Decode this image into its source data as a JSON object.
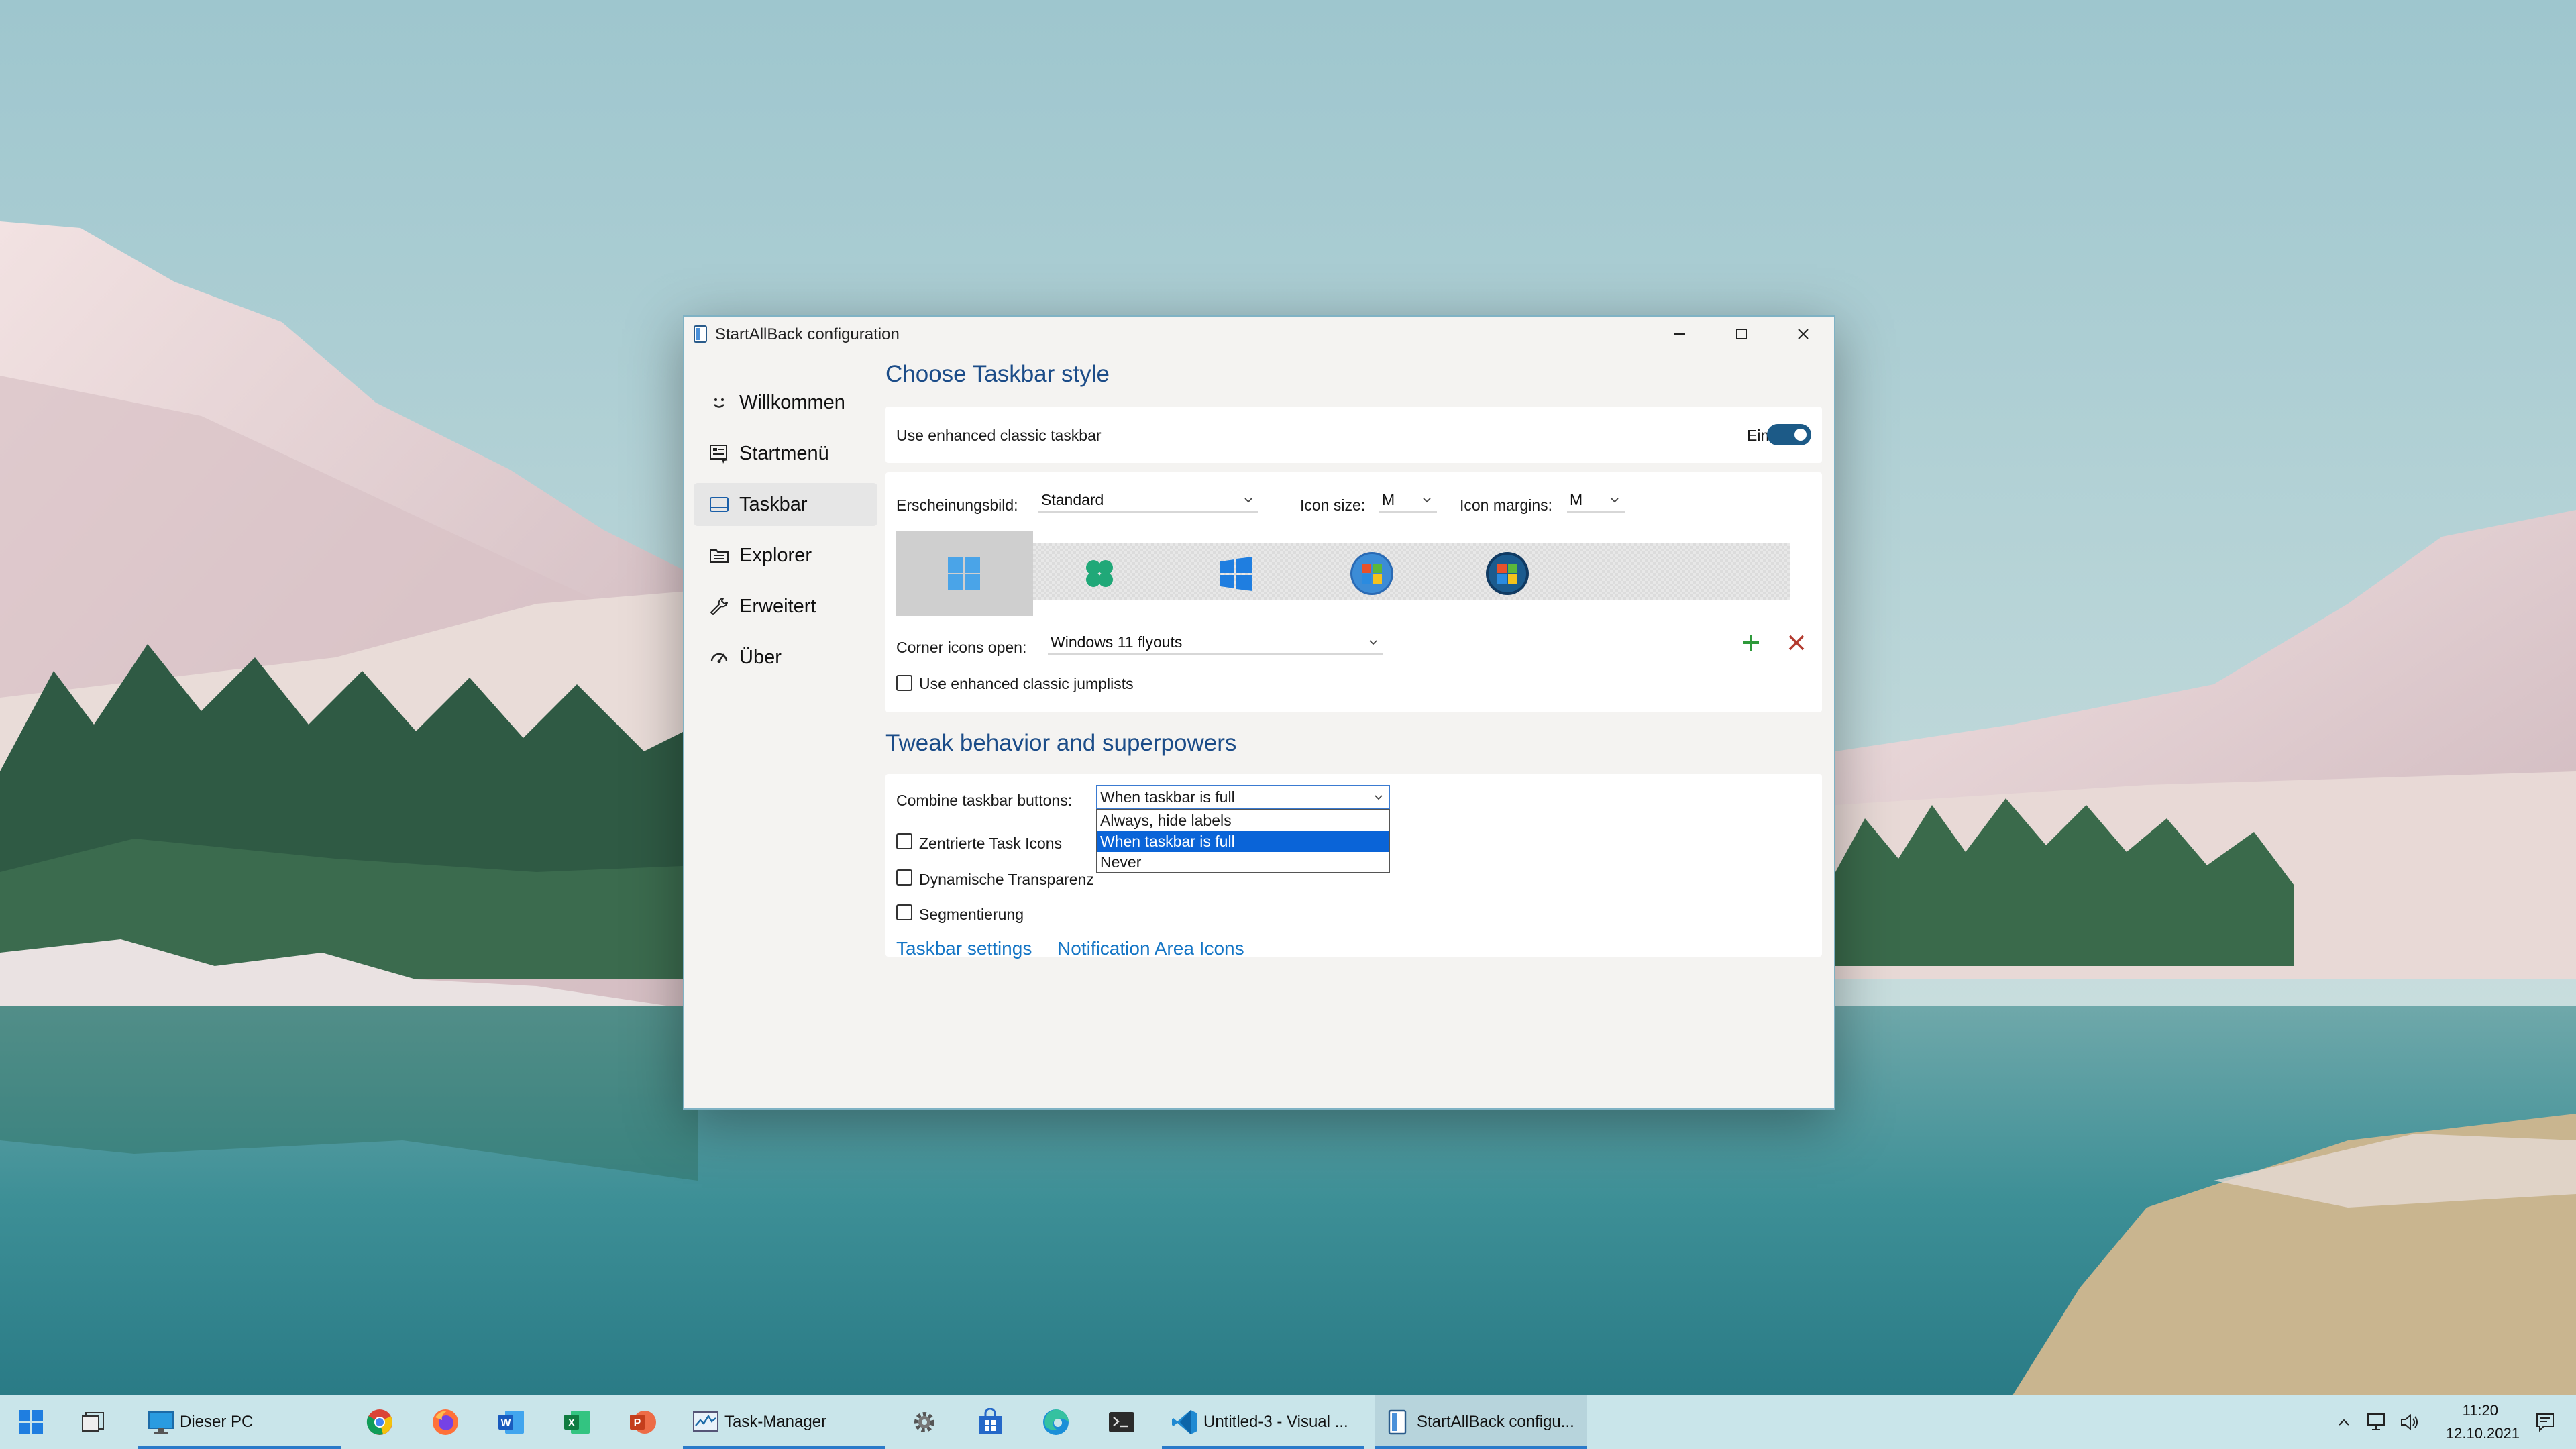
{
  "window": {
    "title": "StartAllBack configuration"
  },
  "sidebar": {
    "items": [
      {
        "label": "Willkommen",
        "icon": "smile-icon"
      },
      {
        "label": "Startmenü",
        "icon": "start-menu-icon"
      },
      {
        "label": "Taskbar",
        "icon": "taskbar-icon",
        "selected": true
      },
      {
        "label": "Explorer",
        "icon": "explorer-icon"
      },
      {
        "label": "Erweitert",
        "icon": "wrench-icon"
      },
      {
        "label": "Über",
        "icon": "gauge-icon"
      }
    ]
  },
  "taskbar_style": {
    "heading": "Choose Taskbar style",
    "enhanced_label": "Use enhanced classic taskbar",
    "toggle_state": "Ein",
    "appearance_label": "Erscheinungsbild:",
    "appearance_value": "Standard",
    "icon_size_label": "Icon size:",
    "icon_size_value": "M",
    "icon_margins_label": "Icon margins:",
    "icon_margins_value": "M",
    "style_options": [
      "windows-11-logo-icon",
      "clover-logo-icon",
      "windows-10-logo-icon",
      "windows-7-orb-icon",
      "windows-vista-orb-icon"
    ],
    "corner_label": "Corner icons open:",
    "corner_value": "Windows 11 flyouts",
    "jumplists_label": "Use enhanced classic jumplists"
  },
  "tweak": {
    "heading": "Tweak behavior and superpowers",
    "combine_label": "Combine taskbar buttons:",
    "combine_value": "When taskbar is full",
    "combine_options": [
      "Always, hide labels",
      "When taskbar is full",
      "Never"
    ],
    "checkboxes": [
      "Zentrierte Task Icons",
      "Dynamische Transparenz",
      "Segmentierung"
    ],
    "links": [
      "Taskbar settings",
      "Notification Area Icons"
    ]
  },
  "taskbar": {
    "buttons": [
      {
        "label": "Dieser PC",
        "icon": "monitor-icon"
      },
      {
        "label": "Task-Manager",
        "icon": "task-manager-icon"
      },
      {
        "label": "Untitled-3 - Visual ...",
        "icon": "vscode-icon"
      },
      {
        "label": "StartAllBack configu...",
        "icon": "startallback-icon"
      }
    ],
    "clock_time": "11:20",
    "clock_date": "12.10.2021"
  },
  "colors": {
    "accent": "#1b4c88",
    "link": "#1475c5",
    "selection": "#0a64d8",
    "taskbar": "#c9e5ea"
  }
}
